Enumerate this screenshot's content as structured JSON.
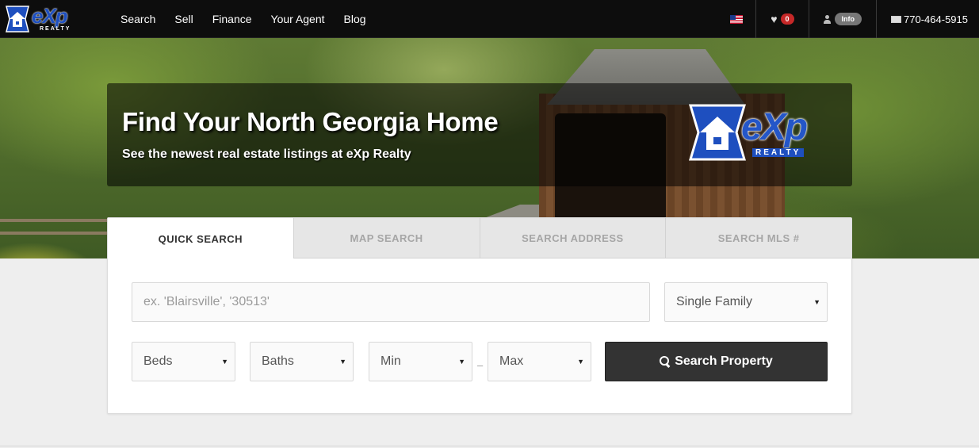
{
  "nav": {
    "links": [
      "Search",
      "Sell",
      "Finance",
      "Your Agent",
      "Blog"
    ],
    "favorites_count": "0",
    "info_label": "Info",
    "phone": "770-464-5915"
  },
  "logo": {
    "text": "eXp",
    "sub": "REALTY"
  },
  "hero": {
    "title": "Find Your North Georgia Home",
    "subtitle": "See the newest real estate listings at eXp Realty"
  },
  "search": {
    "tabs": [
      "QUICK SEARCH",
      "MAP SEARCH",
      "SEARCH ADDRESS",
      "SEARCH MLS #"
    ],
    "active_tab": "QUICK SEARCH",
    "location_placeholder": "ex. 'Blairsville', '30513'",
    "location_value": "",
    "property_type": "Single Family",
    "beds": "Beds",
    "baths": "Baths",
    "min_price": "Min",
    "max_price": "Max",
    "range_separator": "–",
    "submit_label": "Search Property"
  },
  "colors": {
    "nav_bg": "#0d0d0d",
    "brand_blue": "#1e4fbf",
    "button_bg": "#333333",
    "badge_red": "#c62828"
  }
}
